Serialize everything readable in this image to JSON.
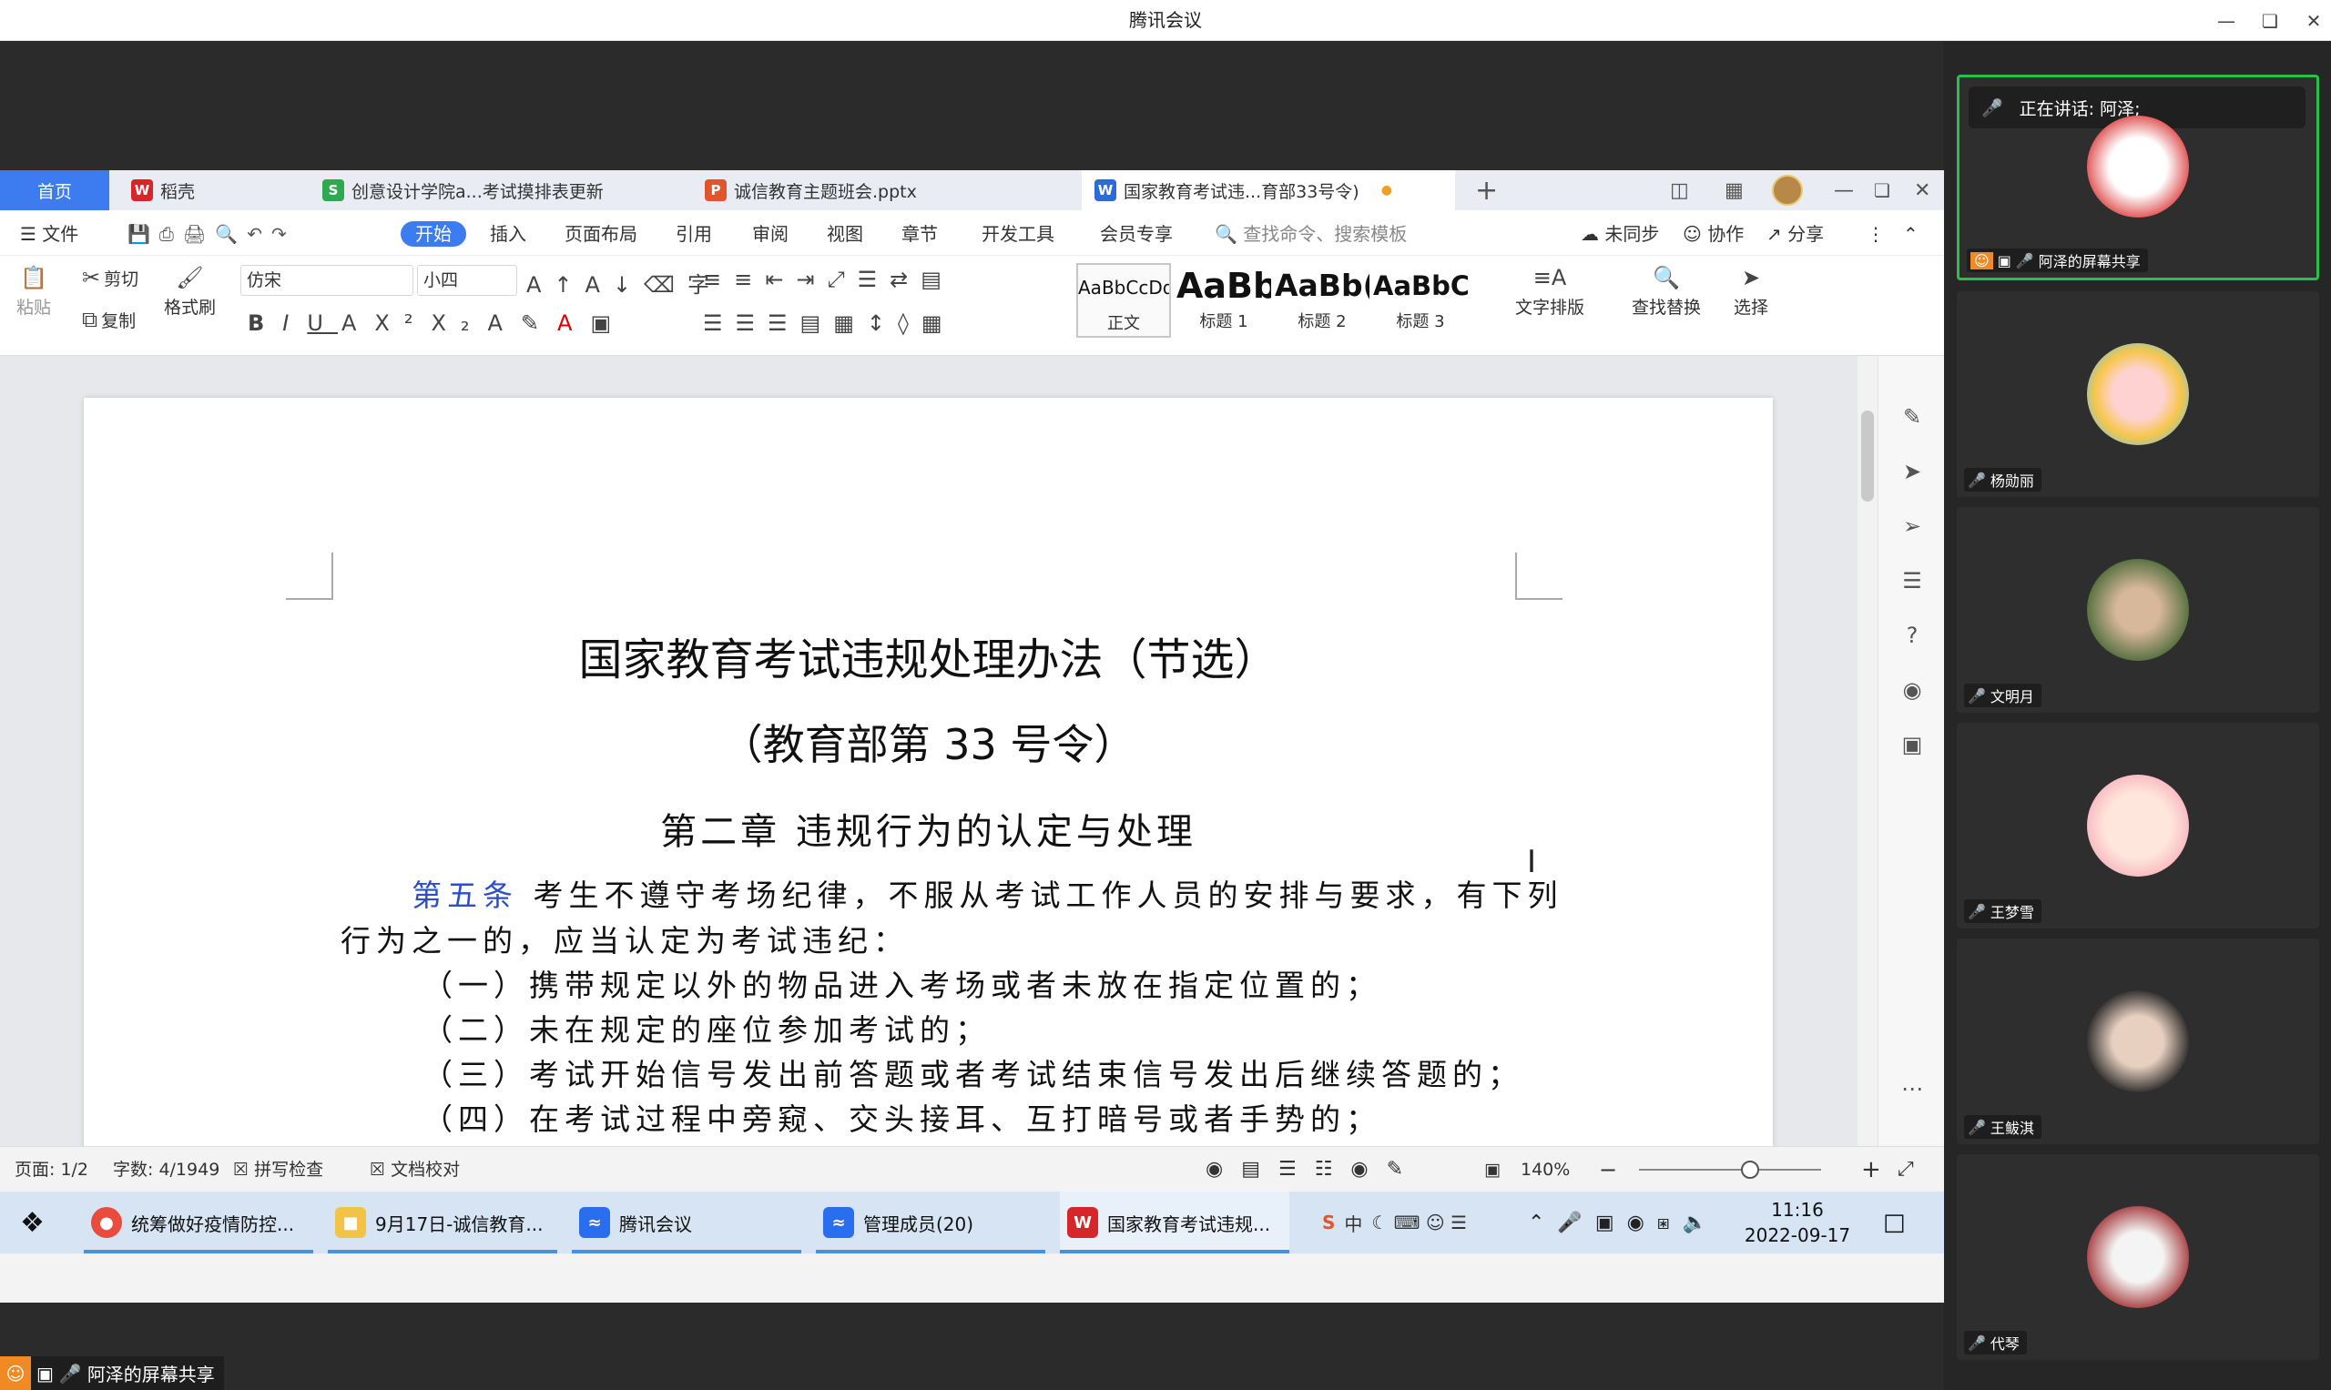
{
  "meeting": {
    "title": "腾讯会议",
    "share_badge": "阿泽的屏幕共享",
    "speaking": "正在讲话: 阿泽;",
    "participants": [
      {
        "name": "阿泽的屏幕共享"
      },
      {
        "name": "杨勋丽"
      },
      {
        "name": "文明月"
      },
      {
        "name": "王梦雪"
      },
      {
        "name": "王鲅淇"
      },
      {
        "name": "代琴"
      }
    ]
  },
  "wps": {
    "tabs": [
      {
        "label": "首页"
      },
      {
        "label": "稻壳"
      },
      {
        "label": "创意设计学院a...考试摸排表更新"
      },
      {
        "label": "诚信教育主题班会.pptx"
      },
      {
        "label": "国家教育考试违...育部33号令)"
      }
    ],
    "menus": [
      "文件",
      "开始",
      "插入",
      "页面布局",
      "引用",
      "审阅",
      "视图",
      "章节",
      "开发工具",
      "会员专享"
    ],
    "search_placeholder": "查找命令、搜索模板",
    "sync": "未同步",
    "collab": "协作",
    "share": "分享",
    "ribbon": {
      "paste": "粘贴",
      "cut": "剪切",
      "copy": "复制",
      "format_painter": "格式刷",
      "font": "仿宋",
      "size": "小四",
      "styles": [
        {
          "preview": "AaBbCcDd",
          "label": "正文"
        },
        {
          "preview": "AaBb",
          "label": "标题 1"
        },
        {
          "preview": "AaBb(",
          "label": "标题 2"
        },
        {
          "preview": "AaBbC",
          "label": "标题 3"
        }
      ],
      "text_layout": "文字排版",
      "find_replace": "查找替换",
      "select": "选择"
    },
    "document": {
      "title": "国家教育考试违规处理办法（节选）",
      "subtitle": "（教育部第 33 号令）",
      "chapter": "第二章  违规行为的认定与处理",
      "article_label": "第五条",
      "article_text": "  考生不遵守考场纪律，不服从考试工作人员的安排与要求，有下列",
      "line2": "行为之一的，应当认定为考试违纪：",
      "items": [
        "（一）携带规定以外的物品进入考场或者未放在指定位置的；",
        "（二）未在规定的座位参加考试的；",
        "（三）考试开始信号发出前答题或者考试结束信号发出后继续答题的；",
        "（四）在考试过程中旁窥、交头接耳、互打暗号或者手势的；"
      ]
    },
    "status": {
      "page": "页面: 1/2",
      "words": "字数: 4/1949",
      "spell": "拼写检查",
      "proof": "文档校对",
      "zoom": "140%"
    }
  },
  "taskbar": {
    "items": [
      {
        "label": "统筹做好疫情防控..."
      },
      {
        "label": "9月17日-诚信教育..."
      },
      {
        "label": "腾讯会议"
      },
      {
        "label": "管理成员(20)"
      },
      {
        "label": "国家教育考试违规..."
      }
    ],
    "time": "11:16",
    "date": "2022-09-17",
    "ime": "中"
  },
  "colors": {
    "accent": "#3c7cf0",
    "active_tile": "#28c04a",
    "wps_red": "#d7262a"
  }
}
